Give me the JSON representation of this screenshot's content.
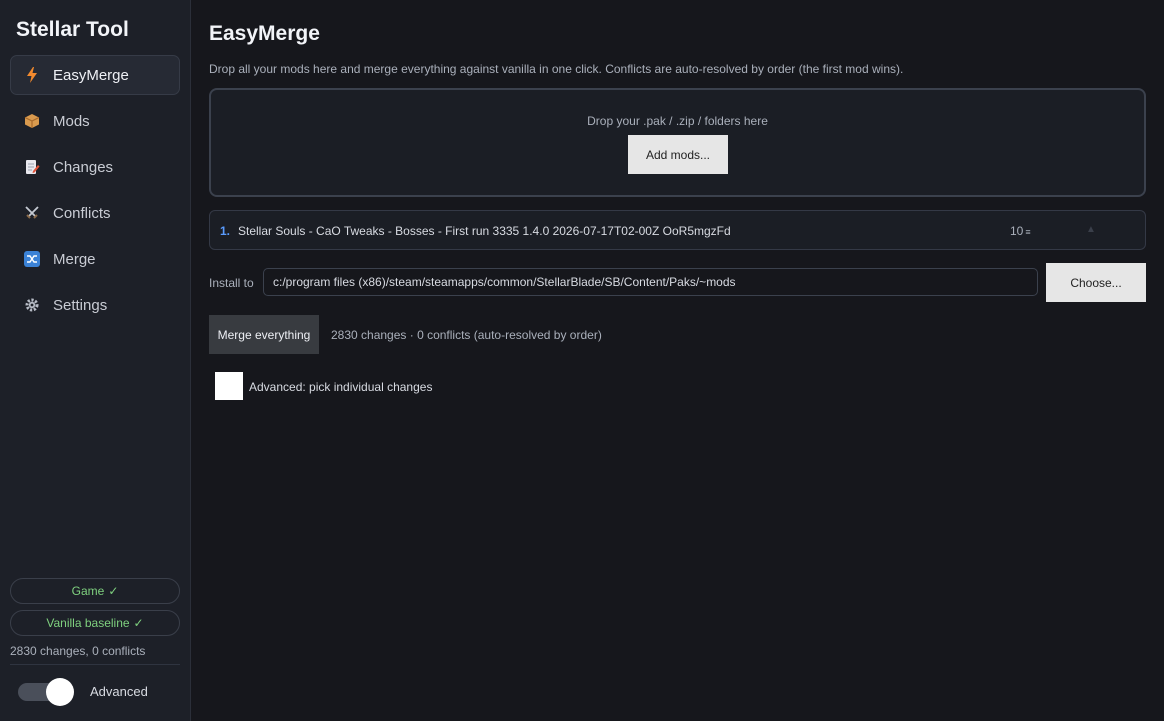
{
  "app": {
    "title": "Stellar Tool"
  },
  "sidebar": {
    "items": [
      {
        "label": "EasyMerge",
        "icon": "lightning-icon",
        "active": true
      },
      {
        "label": "Mods",
        "icon": "package-icon"
      },
      {
        "label": "Changes",
        "icon": "document-edit-icon"
      },
      {
        "label": "Conflicts",
        "icon": "crossed-swords-icon"
      },
      {
        "label": "Merge",
        "icon": "shuffle-icon"
      },
      {
        "label": "Settings",
        "icon": "gear-icon"
      }
    ],
    "game_status": "Game",
    "vanilla_status": "Vanilla baseline",
    "summary": "2830 changes, 0 conflicts",
    "advanced_label": "Advanced",
    "advanced_on": true,
    "check_glyph": "✓"
  },
  "page": {
    "title": "EasyMerge",
    "description": "Drop all your mods here and merge everything against vanilla in one click. Conflicts are auto-resolved by order (the first mod wins).",
    "dropzone_text": "Drop your .pak / .zip / folders here",
    "add_mods_label": "Add mods...",
    "mods": [
      {
        "index": "1.",
        "name": "Stellar Souls - CaO Tweaks - Bosses - First run 3335 1.4.0 2026-07-17T02-00Z OoR5mgzFd",
        "count": "10"
      }
    ],
    "install_label": "Install to",
    "install_path": "c:/program files (x86)/steam/steamapps/common/StellarBlade/SB/Content/Paks/~mods",
    "choose_label": "Choose...",
    "merge_label": "Merge everything",
    "merge_status": "2830 changes · 0 conflicts (auto-resolved by order)",
    "advanced_pick_label": "Advanced: pick individual changes",
    "advanced_pick_checked": false
  },
  "colors": {
    "accent": "#5a9cff",
    "status_ok": "#7fd17f",
    "background": "#16171c",
    "sidebar": "#1d2028"
  }
}
